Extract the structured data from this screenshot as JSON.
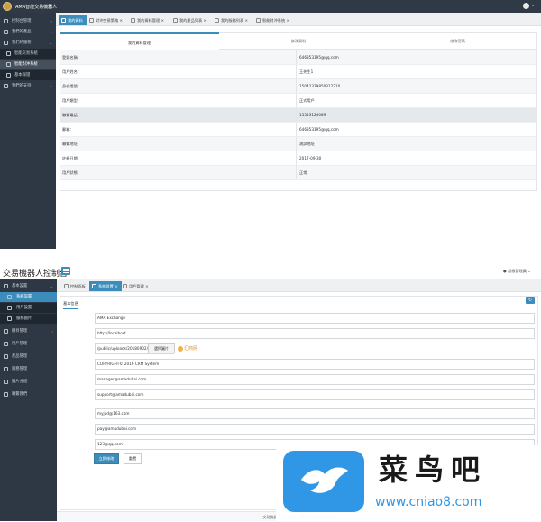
{
  "top": {
    "app_title": "AMA智能交易機器人",
    "sidebar": [
      {
        "label": "控制台管理",
        "icon": "monitor-icon",
        "caret": "‹"
      },
      {
        "label": "我們的產品",
        "icon": "box-icon",
        "caret": "‹"
      },
      {
        "label": "我們的服務",
        "icon": "user-icon",
        "caret": "⌄"
      },
      {
        "label": "智能交易系統",
        "icon": "square-icon",
        "sub": true
      },
      {
        "label": "智能對沖系統",
        "icon": "square-icon",
        "sub": true,
        "active": true
      },
      {
        "label": "基本保證",
        "icon": "square-icon",
        "sub": true
      },
      {
        "label": "我們的支持",
        "icon": "help-icon",
        "caret": "‹"
      }
    ],
    "tabs": [
      {
        "label": "我的資料",
        "active": true
      },
      {
        "label": "對沖交易策略",
        "close": "×"
      },
      {
        "label": "我的資料管理",
        "close": "×"
      },
      {
        "label": "我的產品列表",
        "close": "×"
      },
      {
        "label": "我的服務列表",
        "close": "×"
      },
      {
        "label": "智能對沖系統",
        "close": "×"
      }
    ],
    "section_tabs": [
      "我的資料管理",
      "修改資料",
      "修改密碼"
    ],
    "rows": [
      {
        "label": "登錄名稱：",
        "value": "646353195@qq.com"
      },
      {
        "label": "用戶姓名：",
        "value": "王先生1"
      },
      {
        "label": "身份證號：",
        "value": "15042319850312210"
      },
      {
        "label": "用戶類型：",
        "value": "正式用戶"
      },
      {
        "label": "聯繫電話：",
        "value": "15543124089"
      },
      {
        "label": "郵箱：",
        "value": "646353195@qq.com"
      },
      {
        "label": "聯繫地址：",
        "value": "測試地址"
      },
      {
        "label": "註冊日期：",
        "value": "2017-09-30"
      },
      {
        "label": "用戶狀態：",
        "value": "正常"
      }
    ]
  },
  "bottom": {
    "title": "交易機器人控制台",
    "admin_label": "超級管理員",
    "sidebar": [
      {
        "label": "基本設置",
        "icon": "gear-icon",
        "caret": "⌄"
      },
      {
        "label": "系統設置",
        "icon": "square-icon",
        "sub": true,
        "active": true
      },
      {
        "label": "用戶設置",
        "icon": "square-icon",
        "sub": true
      },
      {
        "label": "服務圖片",
        "icon": "square-icon",
        "sub": true
      },
      {
        "label": "欄目管理",
        "icon": "list-icon",
        "caret": "‹"
      },
      {
        "label": "用戶管理",
        "icon": "user-icon"
      },
      {
        "label": "產品管理",
        "icon": "box-icon"
      },
      {
        "label": "服務管理",
        "icon": "folder-icon"
      },
      {
        "label": "圖片分組",
        "icon": "image-icon"
      },
      {
        "label": "聯繫我們",
        "icon": "phone-icon"
      }
    ],
    "tabs": [
      {
        "label": "控制面板"
      },
      {
        "label": "系統設置",
        "active": true,
        "close": "×"
      },
      {
        "label": "用戶管理",
        "close": "×"
      }
    ],
    "panel_tab": "基本信息",
    "refresh_icon": "↻",
    "fields": [
      {
        "label": "站點名稱",
        "value": "AMA Exchange"
      },
      {
        "label": "站點域名",
        "value": "http://localhost"
      },
      {
        "label": "Logo",
        "value": "/public/uploads/20180902/9"
      },
      {
        "label": "備案號",
        "value": "COPYRIGHT© 2016 CRM System"
      },
      {
        "label": "站務郵箱",
        "value": "manager@amadubai.com"
      },
      {
        "label": "技術支持郵箱",
        "value": "support@amadubai.com"
      },
      {
        "label": "客戶郵箱",
        "value": "myjbd@163.com"
      },
      {
        "label": "加入金郵箱",
        "value": "pay@amadubai.com"
      },
      {
        "label": "通知郵箱",
        "value": "123@qq.com"
      }
    ],
    "select_image_label": "選擇圖片",
    "logo_preview_text": "汇商网",
    "save_label": "立即修改",
    "reset_label": "重置",
    "footer": "交易機器人 © 2017 · AMA Trading Center"
  },
  "watermark": {
    "text": "菜鸟吧",
    "url": "www.cniao8.com"
  },
  "colors": {
    "accent": "#3c8dbc",
    "sidebar": "#2d3844",
    "topbar": "#2f3a46",
    "watermark": "#2f97e6"
  }
}
